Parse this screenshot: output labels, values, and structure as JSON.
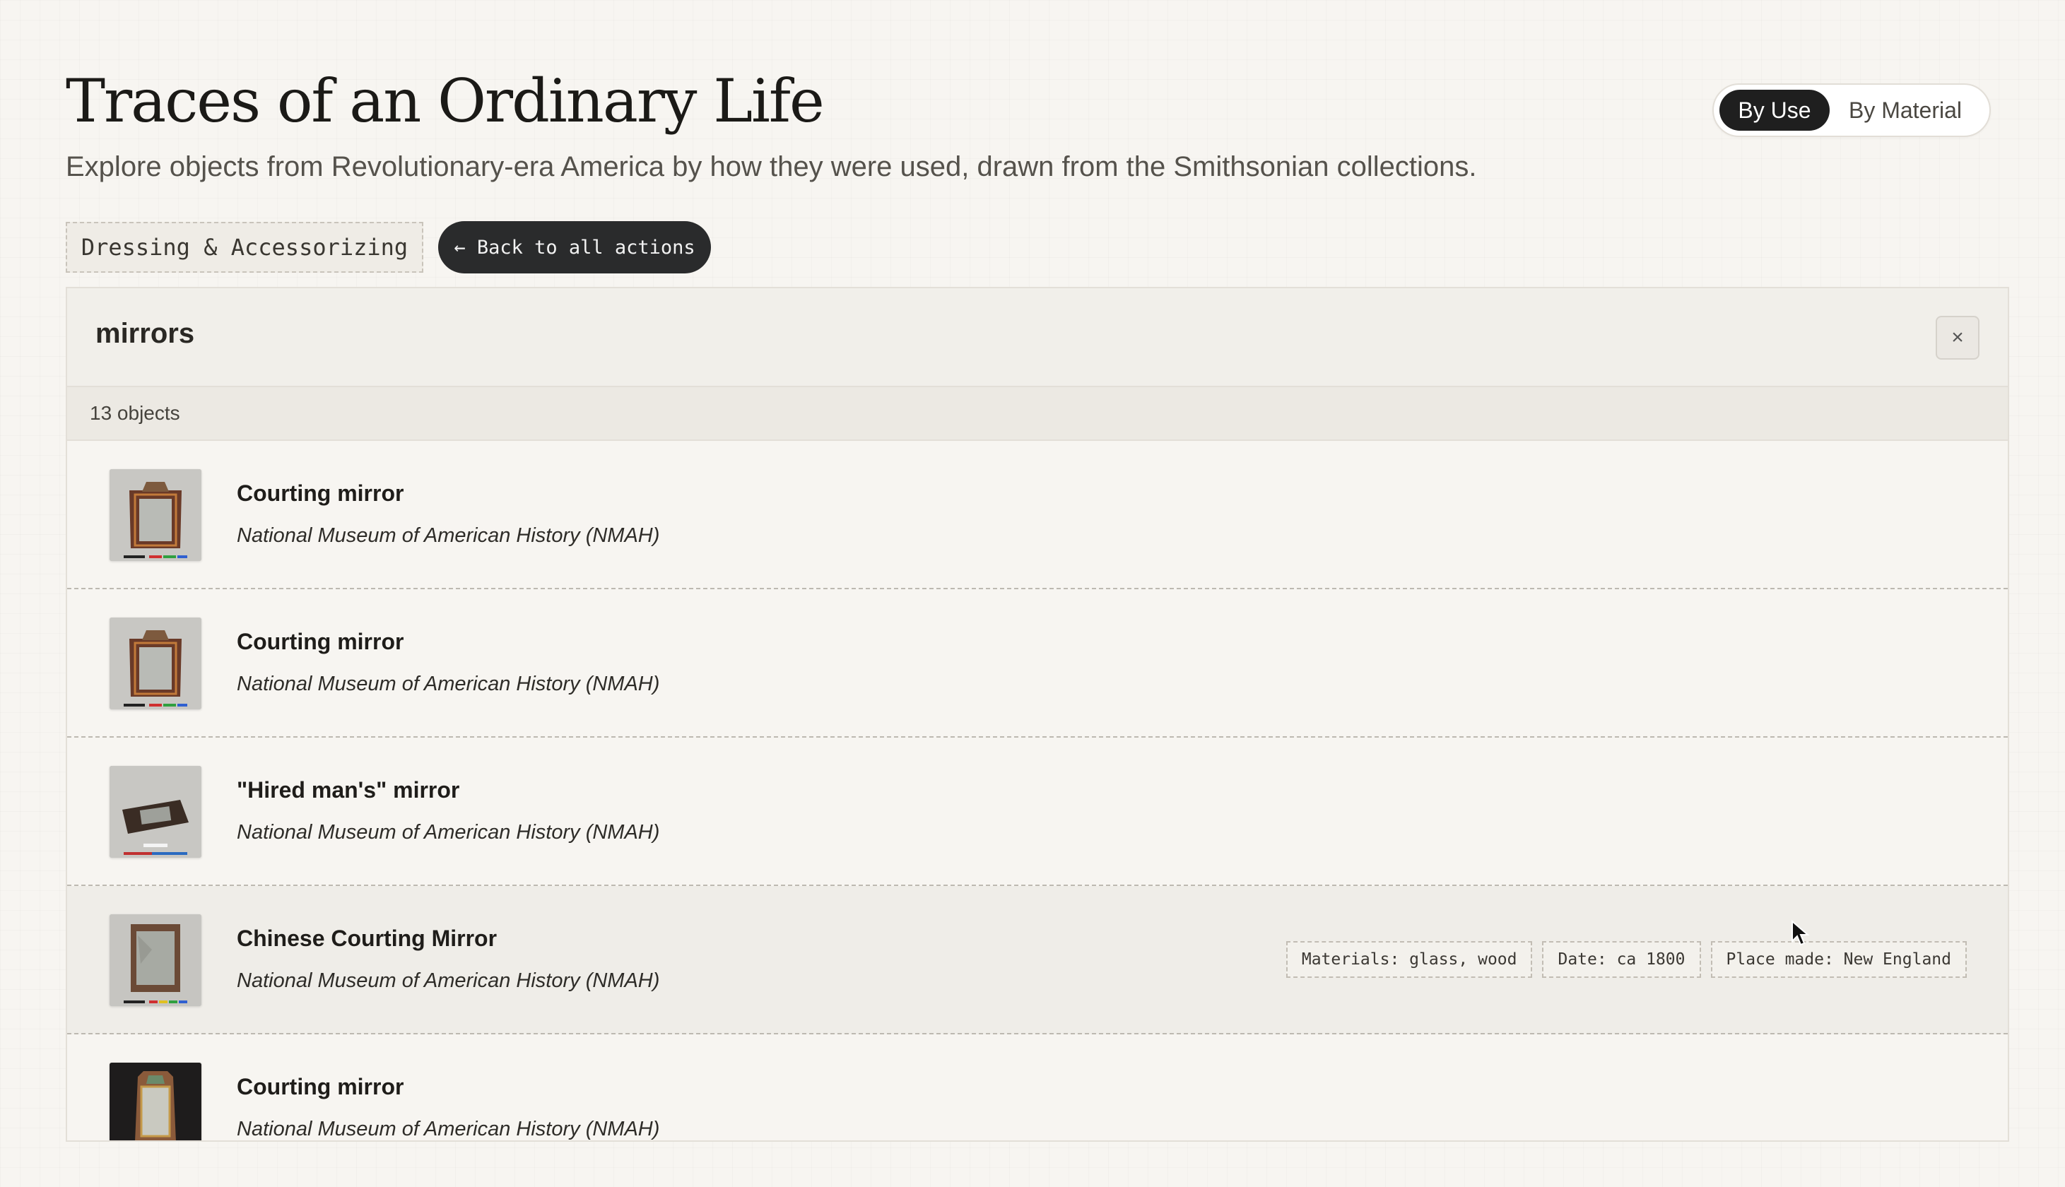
{
  "header": {
    "title": "Traces of an Ordinary Life",
    "subtitle": "Explore objects from Revolutionary-era America by how they were used, drawn from the Smithsonian collections."
  },
  "view_toggle": {
    "options": [
      {
        "label": "By Use",
        "active": true
      },
      {
        "label": "By Material",
        "active": false
      }
    ]
  },
  "filter": {
    "category": "Dressing & Accessorizing",
    "back_label": "← Back to all actions"
  },
  "panel": {
    "title": "mirrors",
    "close_icon": "×",
    "count": "13 objects"
  },
  "items": [
    {
      "title": "Courting mirror",
      "museum": "National Museum of American History (NMAH)",
      "thumb": "mirror-ornate",
      "tags": []
    },
    {
      "title": "Courting mirror",
      "museum": "National Museum of American History (NMAH)",
      "thumb": "mirror-ornate",
      "tags": []
    },
    {
      "title": "\"Hired man's\" mirror",
      "museum": "National Museum of American History (NMAH)",
      "thumb": "mirror-small",
      "tags": []
    },
    {
      "title": "Chinese Courting Mirror",
      "museum": "National Museum of American History (NMAH)",
      "thumb": "mirror-painted",
      "tags": [
        "Materials: glass, wood",
        "Date: ca 1800",
        "Place made: New England"
      ],
      "hover": true
    },
    {
      "title": "Courting mirror",
      "museum": "National Museum of American History (NMAH)",
      "thumb": "mirror-dark",
      "tags": []
    }
  ],
  "colors": {
    "background": "#f7f5f1",
    "accent_dark": "#1f1f1f",
    "panel_header": "#f1efea"
  }
}
